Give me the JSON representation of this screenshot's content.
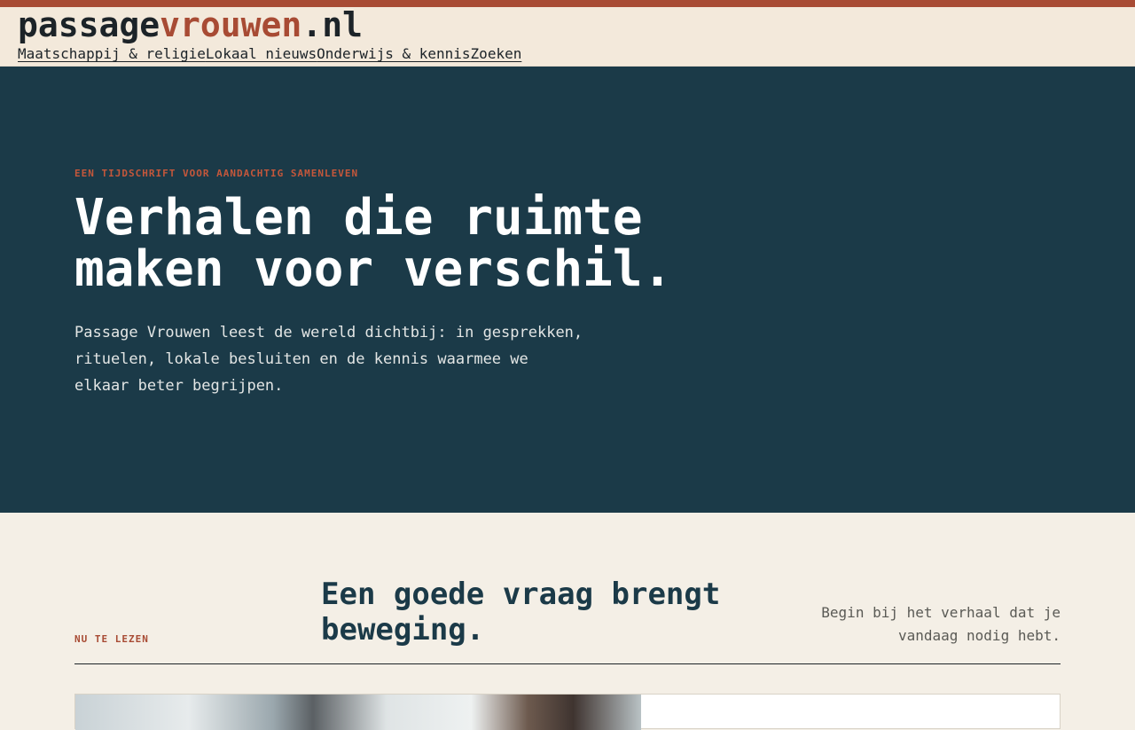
{
  "header": {
    "logo_part1": "passage",
    "logo_part2": "vrouwen",
    "logo_part3": ".nl",
    "nav": [
      {
        "label": "Maatschappij & religie"
      },
      {
        "label": "Lokaal nieuws"
      },
      {
        "label": "Onderwijs & kennis"
      },
      {
        "label": "Zoeken"
      }
    ]
  },
  "hero": {
    "eyebrow": "EEN TIJDSCHRIFT VOOR AANDACHTIG SAMENLEVEN",
    "title_line1": "Verhalen die ruimte",
    "title_line2": "maken voor verschil.",
    "text": "Passage Vrouwen leest de wereld dichtbij: in gesprekken, rituelen, lokale besluiten en de kennis waarmee we elkaar beter begrijpen."
  },
  "section": {
    "label": "NU TE LEZEN",
    "title": "Een goede vraag brengt beweging.",
    "aside": "Begin bij het verhaal dat je vandaag nodig hebt."
  },
  "colors": {
    "accent": "#a84b34",
    "hero_bg": "#1b3a48",
    "page_bg": "#f4efe6"
  }
}
